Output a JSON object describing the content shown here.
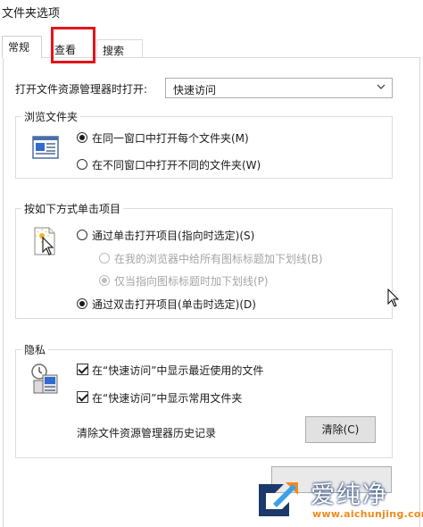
{
  "window": {
    "title": "文件夹选项"
  },
  "tabs": [
    {
      "label": "常规",
      "active": true
    },
    {
      "label": "查看",
      "active": false
    },
    {
      "label": "搜索",
      "active": false
    }
  ],
  "open_explorer": {
    "label": "打开文件资源管理器时打开:",
    "value": "快速访问"
  },
  "browse_folders": {
    "title": "浏览文件夹",
    "options": [
      {
        "label": "在同一窗口中打开每个文件夹(M)",
        "checked": true
      },
      {
        "label": "在不同窗口中打开不同的文件夹(W)",
        "checked": false
      }
    ]
  },
  "click_items": {
    "title": "按如下方式单击项目",
    "options": [
      {
        "label": "通过单击打开项目(指向时选定)(S)",
        "checked": false,
        "disabled": false
      },
      {
        "label": "在我的浏览器中给所有图标标题加下划线(B)",
        "checked": false,
        "disabled": true
      },
      {
        "label": "仅当指向图标标题时加下划线(P)",
        "checked": true,
        "disabled": true
      },
      {
        "label": "通过双击打开项目(单击时选定)(D)",
        "checked": true,
        "disabled": false
      }
    ]
  },
  "privacy": {
    "title": "隐私",
    "options": [
      {
        "label": "在“快速访问”中显示最近使用的文件",
        "checked": true
      },
      {
        "label": "在“快速访问”中显示常用文件夹",
        "checked": true
      }
    ],
    "clear_label": "清除文件资源管理器历史记录",
    "clear_button": "清除(C)"
  },
  "watermark": {
    "name": "爱纯净",
    "url": "www.aichunjing.com"
  },
  "colors": {
    "highlight": "#e3141b",
    "watermark_url": "#f28a1e",
    "watermark_outline": "#1b3a6b"
  }
}
